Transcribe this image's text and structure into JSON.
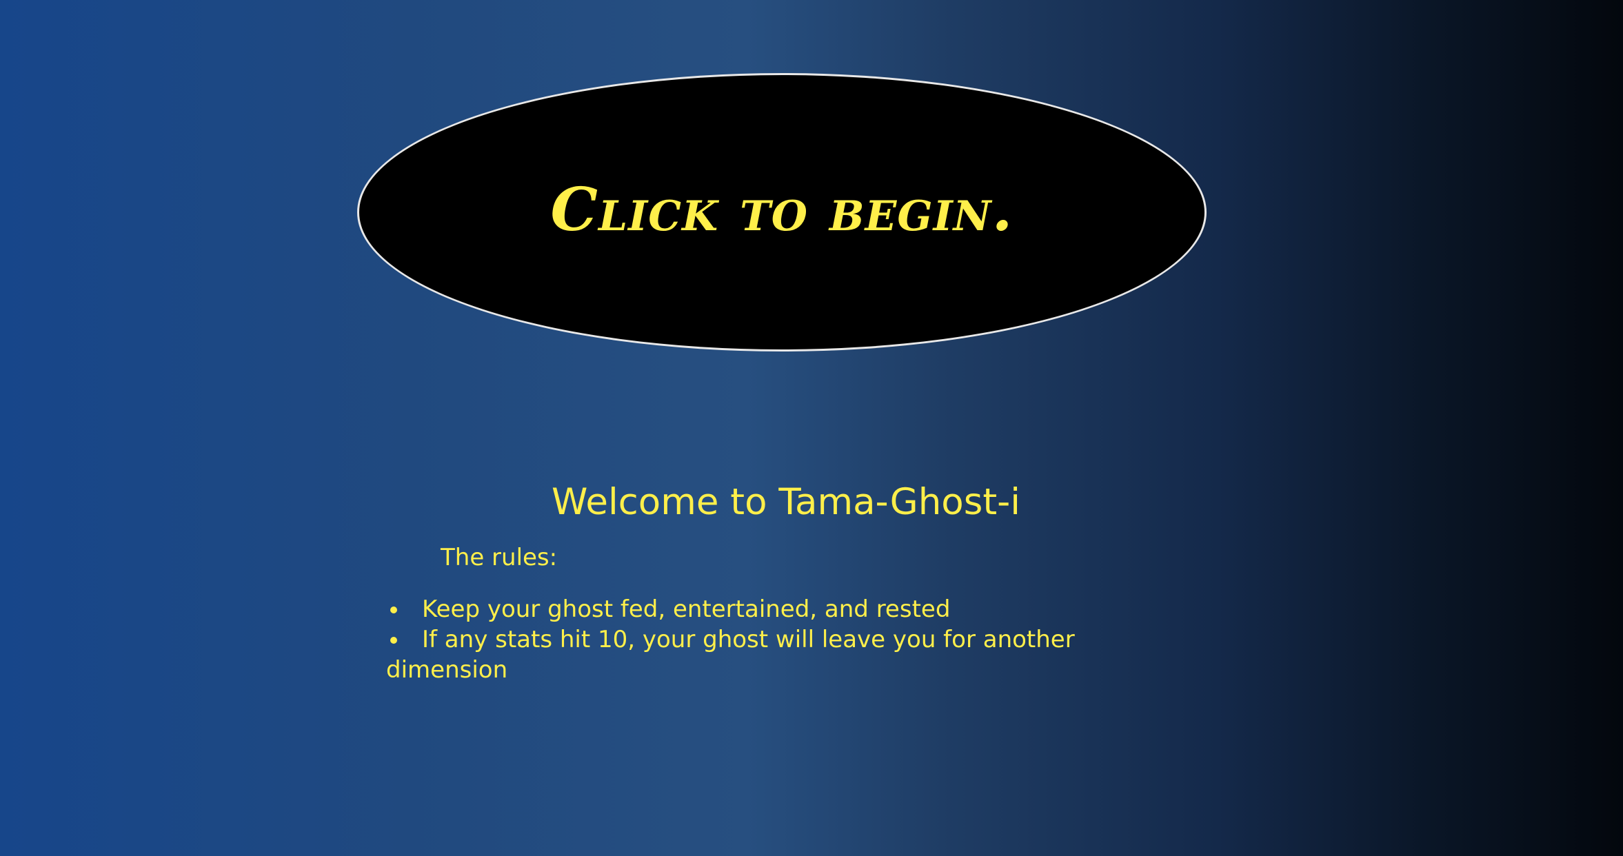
{
  "start": {
    "label": "Click to begin."
  },
  "welcome": {
    "title": "Welcome to Tama-Ghost-i",
    "rules_label": "The rules:",
    "rules": [
      "Keep your ghost fed, entertained, and rested",
      "If any stats hit 10, your ghost will leave you for another dimension"
    ]
  },
  "colors": {
    "accent": "#ffef4a",
    "button_bg": "#000000",
    "button_border": "#e8e8e8"
  }
}
